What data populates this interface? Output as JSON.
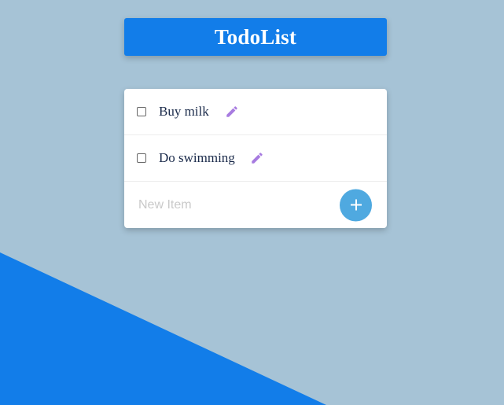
{
  "header": {
    "title": "TodoList"
  },
  "todos": [
    {
      "text": "Buy milk",
      "checked": false
    },
    {
      "text": "Do swimming",
      "checked": false
    }
  ],
  "new_item": {
    "value": "",
    "placeholder": "New Item"
  },
  "colors": {
    "background": "#a6c3d6",
    "accent": "#127de9",
    "add_button": "#4fa9e0",
    "edit_icon": "#a77be0"
  },
  "icons": {
    "edit": "pencil-icon",
    "add": "plus-icon"
  }
}
